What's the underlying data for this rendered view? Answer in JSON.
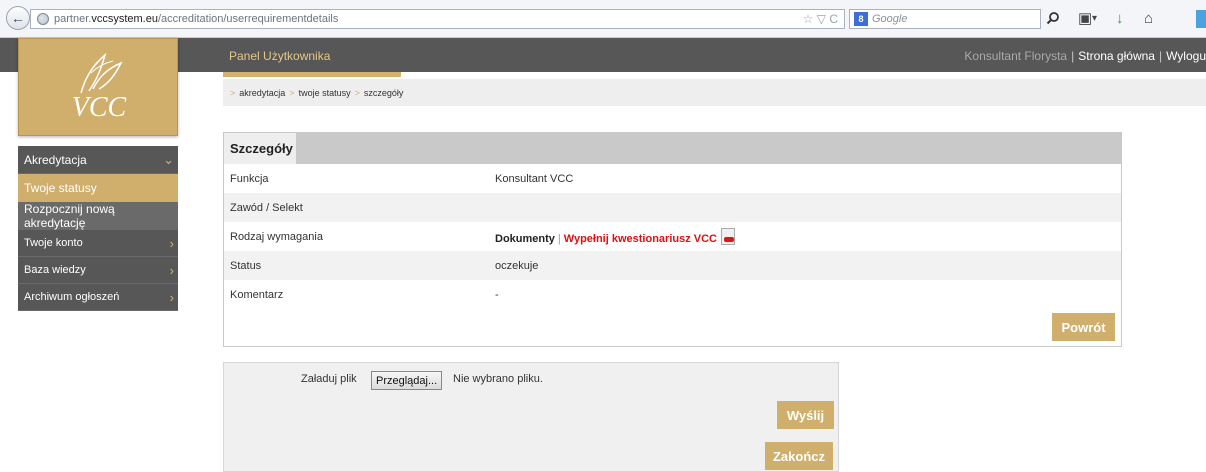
{
  "browser": {
    "url_prefix": "partner.",
    "url_domain": "vccsystem.eu",
    "url_path": "/accreditation/userrequirementdetails",
    "url_controls": "☆ ▽ C",
    "search_placeholder": "Google"
  },
  "header": {
    "panel_title": "Panel Użytkownika",
    "user_name": "Konsultant Florysta",
    "home_link": "Strona główna",
    "logout_link": "Wylogu"
  },
  "breadcrumb": [
    "akredytacja",
    "twoje statusy",
    "szczegóły"
  ],
  "logo": {
    "text": "VCC"
  },
  "sidebar": {
    "items": [
      {
        "label": "Akredytacja"
      },
      {
        "label": "Twoje statusy"
      },
      {
        "label": "Rozpocznij nową akredytację"
      },
      {
        "label": "Twoje konto"
      },
      {
        "label": "Baza wiedzy"
      },
      {
        "label": "Archiwum ogłoszeń"
      }
    ]
  },
  "details": {
    "title": "Szczegóły",
    "rows": [
      {
        "label": "Funkcja",
        "value": "Konsultant VCC"
      },
      {
        "label": "Zawód / Selekt",
        "value": ""
      },
      {
        "label": "Rodzaj wymagania",
        "doc_link": "Dokumenty",
        "separator": "|",
        "fill_link": "Wypełnij kwestionariusz VCC"
      },
      {
        "label": "Status",
        "value": "oczekuje"
      },
      {
        "label": "Komentarz",
        "value": "-"
      }
    ],
    "back_button": "Powrót"
  },
  "upload": {
    "label": "Załaduj plik",
    "browse_button": "Przeglądaj...",
    "no_file_text": "Nie wybrano pliku.",
    "send_button": "Wyślij",
    "finish_button": "Zakończ"
  },
  "colors": {
    "accent_gold": "#d0ae6b",
    "dark_bar": "#575757",
    "link_red": "#e01010"
  }
}
